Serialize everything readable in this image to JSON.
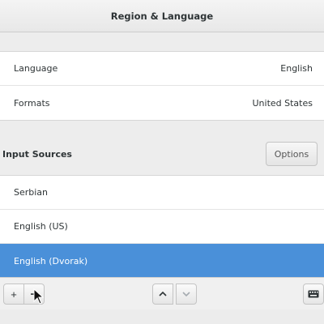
{
  "window": {
    "title": "Region & Language"
  },
  "region": {
    "rows": [
      {
        "label": "Language",
        "value": "English"
      },
      {
        "label": "Formats",
        "value": "United States"
      }
    ]
  },
  "input_sources": {
    "heading": "Input Sources",
    "options_label": "Options",
    "items": [
      {
        "label": "Serbian",
        "selected": false
      },
      {
        "label": "English (US)",
        "selected": false
      },
      {
        "label": "English (Dvorak)",
        "selected": true
      }
    ]
  },
  "toolbar": {
    "add_symbol": "+",
    "buttons": [
      "plus-icon",
      "minus-icon",
      "chevron-up-icon",
      "chevron-down-icon",
      "keyboard-icon"
    ]
  },
  "colors": {
    "selection": "#4a90d9"
  }
}
